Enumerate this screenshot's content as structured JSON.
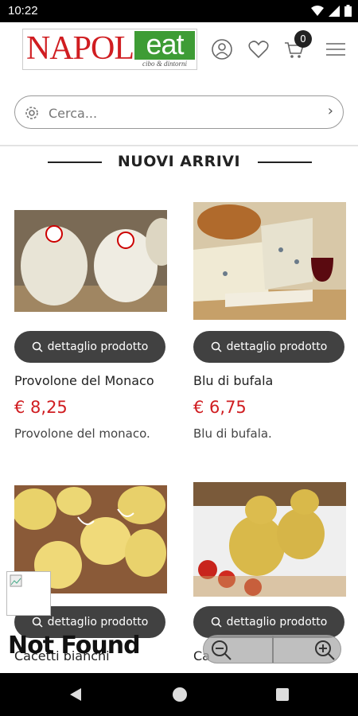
{
  "status_bar": {
    "time": "10:22"
  },
  "header": {
    "logo_left": "NAPOL",
    "logo_right": "eat",
    "logo_tagline": "cibo & dintorni",
    "cart_count": "0"
  },
  "search": {
    "placeholder": "Cerca..."
  },
  "section": {
    "title": "NUOVI ARRIVI"
  },
  "products": [
    {
      "name": "Provolone del Monaco",
      "price": "€ 8,25",
      "desc": "Provolone del monaco.",
      "button": "dettaglio prodotto"
    },
    {
      "name": "Blu di bufala",
      "price": "€ 6,75",
      "desc": "Blu di bufala.",
      "button": "dettaglio prodotto"
    },
    {
      "name": "Cacetti bianchi",
      "button": "dettaglio prodotto"
    },
    {
      "name": "Ca",
      "button": "dettaglio prodotto"
    }
  ],
  "overlay": {
    "not_found": "Not Found"
  },
  "colors": {
    "price": "#d01d21",
    "button": "#414141",
    "logo_red": "#d01d21",
    "logo_green": "#3e9c35"
  }
}
